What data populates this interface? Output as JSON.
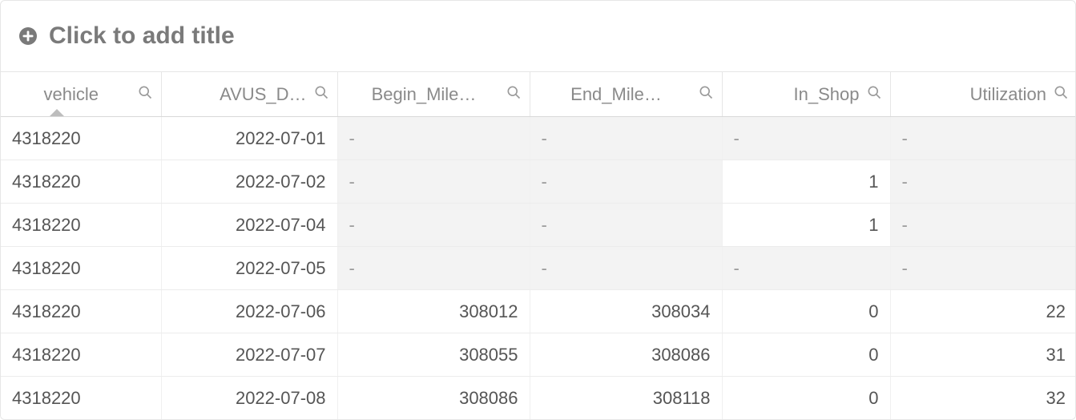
{
  "title": "Click to add title",
  "columns": [
    {
      "label": "vehicle",
      "align": "left",
      "sorted": true
    },
    {
      "label": "AVUS_D…",
      "align": "right",
      "sorted": false
    },
    {
      "label": "Begin_Mile…",
      "align": "left",
      "sorted": false
    },
    {
      "label": "End_Mile…",
      "align": "left",
      "sorted": false
    },
    {
      "label": "In_Shop",
      "align": "right",
      "sorted": false
    },
    {
      "label": "Utilization",
      "align": "right",
      "sorted": false
    }
  ],
  "null_text": "-",
  "rows": [
    {
      "vehicle": "4318220",
      "date": "2022-07-01",
      "begin": null,
      "end": null,
      "in_shop": null,
      "util": null
    },
    {
      "vehicle": "4318220",
      "date": "2022-07-02",
      "begin": null,
      "end": null,
      "in_shop": "1",
      "util": null
    },
    {
      "vehicle": "4318220",
      "date": "2022-07-04",
      "begin": null,
      "end": null,
      "in_shop": "1",
      "util": null
    },
    {
      "vehicle": "4318220",
      "date": "2022-07-05",
      "begin": null,
      "end": null,
      "in_shop": null,
      "util": null
    },
    {
      "vehicle": "4318220",
      "date": "2022-07-06",
      "begin": "308012",
      "end": "308034",
      "in_shop": "0",
      "util": "22"
    },
    {
      "vehicle": "4318220",
      "date": "2022-07-07",
      "begin": "308055",
      "end": "308086",
      "in_shop": "0",
      "util": "31"
    },
    {
      "vehicle": "4318220",
      "date": "2022-07-08",
      "begin": "308086",
      "end": "308118",
      "in_shop": "0",
      "util": "32"
    }
  ],
  "col_align": {
    "vehicle": "left",
    "date": "right",
    "begin": "right",
    "end": "right",
    "in_shop": "right",
    "util": "right"
  }
}
